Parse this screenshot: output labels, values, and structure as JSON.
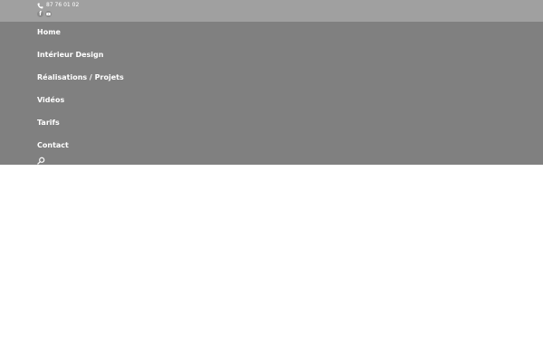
{
  "topbar": {
    "phone": "87 76 01 02",
    "phone_icon": "phone-icon",
    "socials": [
      {
        "name": "facebook-icon",
        "glyph": "f"
      },
      {
        "name": "youtube-icon",
        "glyph": "yt"
      }
    ]
  },
  "nav": {
    "items": [
      {
        "label": "Home"
      },
      {
        "label": "Intérieur Design"
      },
      {
        "label": "Réalisations / Projets"
      },
      {
        "label": "Vidéos"
      },
      {
        "label": "Tarifs"
      },
      {
        "label": "Contact"
      }
    ],
    "search_icon": "search-icon"
  },
  "colors": {
    "topbar_bg": "#a0a0a0",
    "nav_bg": "#808080",
    "text": "#ffffff",
    "page_bg": "#ffffff"
  }
}
